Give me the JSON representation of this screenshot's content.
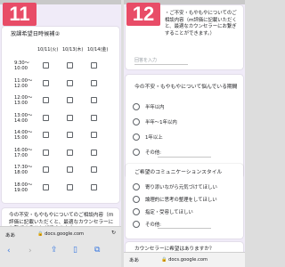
{
  "screen1": {
    "step": "11",
    "grid_title": "放課希望日時候補②",
    "columns": [
      "10/11(火)",
      "10/13(木)",
      "10/14(金)"
    ],
    "times": [
      "9:30～\n10:00",
      "11:00～\n12:00",
      "12:00～\n13:00",
      "13:00～\n14:00",
      "14:00～\n15:00",
      "16:00～\n17:00",
      "17:30～\n18:00",
      "18:00～\n19:00"
    ],
    "next_question": "今の不安・もやもやについてのご相談内容（ｍ評価に記載いただくと、最適なカウンセラーにお繋ぎすることができます。）",
    "address_prefix": "ああ",
    "url": "docs.google.com"
  },
  "screen2": {
    "step": "12",
    "q1_text": "・ご不安・もやもやについてのご相談内容（ｍ評価に記載いただくと、最適なカウンセラーにお繋ぎすることができます。）",
    "q1_placeholder": "回答を入力",
    "q2_title": "今の不安・もやもやについて悩んでいる期間",
    "q2_options": [
      "半年以内",
      "半年〜1年以内",
      "1年以上",
      "その他:"
    ],
    "q3_title": "ご希望のコミュニケーションスタイル",
    "q3_options": [
      "寄り添いながら元気づけてほしい",
      "論理的に思考の整理をしてほしい",
      "指定・受容してほしい",
      "その他:"
    ],
    "q4_title": "カウンセラーに希望はありますか？",
    "address_prefix": "ああ",
    "url": "docs.google.com"
  }
}
